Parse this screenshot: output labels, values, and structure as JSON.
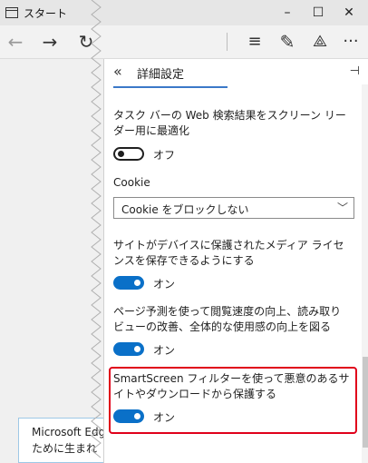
{
  "browser": {
    "tab_title": "スタート",
    "controls": {
      "minimize": "–",
      "maximize": "☐",
      "close": "✕"
    },
    "nav": {
      "back": "←",
      "forward": "→",
      "refresh": "↻",
      "hub": "≡",
      "note": "✎",
      "share": "⟁",
      "more": "···"
    }
  },
  "page_behind": {
    "card_line1": "Microsoft Edge",
    "card_line2": "ために生まれ"
  },
  "settings_panel": {
    "collapse_icon": "«",
    "title": "詳細設定",
    "pin_icon": "⊣",
    "settings": [
      {
        "label": "タスク バーの Web 検索結果をスクリーン リーダー用に最適化",
        "state": "オフ",
        "on": false
      },
      {
        "label": "Cookie",
        "select_value": "Cookie をブロックしない"
      },
      {
        "label": "サイトがデバイスに保護されたメディア ライセンスを保存できるようにする",
        "state": "オン",
        "on": true
      },
      {
        "label": "ページ予測を使って閲覧速度の向上、読み取りビューの改善、全体的な使用感の向上を図る",
        "state": "オン",
        "on": true
      },
      {
        "label": "SmartScreen フィルターを使って悪意のあるサイトやダウンロードから保護する",
        "state": "オン",
        "on": true,
        "highlighted": true
      }
    ]
  },
  "colors": {
    "accent": "#0a70c8",
    "highlight": "#e0001a"
  }
}
